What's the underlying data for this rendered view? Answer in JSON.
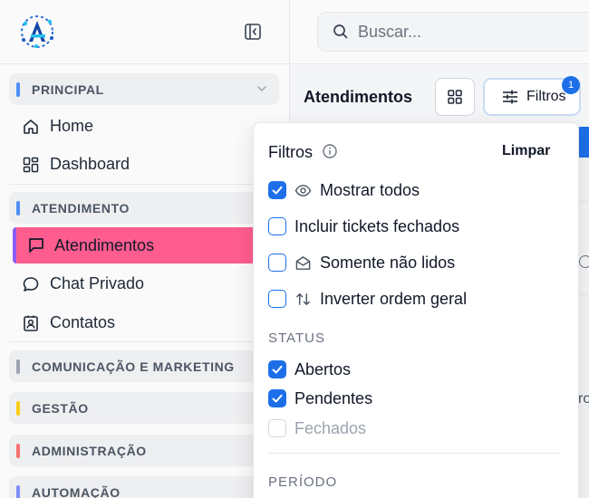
{
  "colors": {
    "accent": "#1d6fe8",
    "active_item": "#ff5d8f",
    "section_principal": "#4f8ff7",
    "section_atendimento": "#4f8ff7",
    "section_comunicacao": "#9ca3af",
    "section_gestao": "#facc15",
    "section_administracao": "#f87171",
    "section_automacao": "#818cf8"
  },
  "sidebar": {
    "logo_icon": "app-logo-a",
    "collapse_icon": "sidebar-collapse-icon",
    "sections": [
      {
        "label": "PRINCIPAL",
        "items": [
          {
            "label": "Home",
            "icon": "home-icon"
          },
          {
            "label": "Dashboard",
            "icon": "dashboard-icon"
          }
        ]
      },
      {
        "label": "ATENDIMENTO",
        "items": [
          {
            "label": "Atendimentos",
            "icon": "chat-square-icon",
            "active": true
          },
          {
            "label": "Chat Privado",
            "icon": "chat-bubble-icon"
          },
          {
            "label": "Contatos",
            "icon": "contact-icon"
          }
        ]
      },
      {
        "label": "COMUNICAÇÃO E MARKETING"
      },
      {
        "label": "GESTÃO"
      },
      {
        "label": "ADMINISTRAÇÃO"
      },
      {
        "label": "AUTOMAÇÃO"
      }
    ]
  },
  "header": {
    "search_placeholder": "Buscar..."
  },
  "main": {
    "title": "Atendimentos",
    "filter_button_label": "Filtros",
    "filter_badge": "1",
    "partial_text": "ro"
  },
  "filters": {
    "title": "Filtros",
    "clear_label": "Limpar",
    "options": [
      {
        "label": "Mostrar todos",
        "checked": true,
        "icon": "eye-icon"
      },
      {
        "label": "Incluir tickets fechados",
        "checked": false
      },
      {
        "label": "Somente não lidos",
        "checked": false,
        "icon": "envelope-open-icon"
      },
      {
        "label": "Inverter ordem geral",
        "checked": false,
        "icon": "sort-arrows-icon"
      }
    ],
    "status_label": "STATUS",
    "status": [
      {
        "label": "Abertos",
        "checked": true
      },
      {
        "label": "Pendentes",
        "checked": true
      },
      {
        "label": "Fechados",
        "checked": false,
        "disabled": true
      }
    ],
    "period_label": "PERÍODO"
  }
}
